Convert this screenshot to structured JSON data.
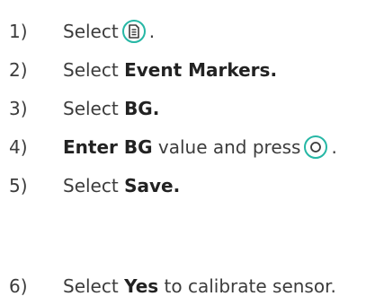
{
  "accent_color": "#26b7a5",
  "steps": [
    {
      "number": "1)",
      "text_a": "Select",
      "icon": "menu-document-icon",
      "text_b": "."
    },
    {
      "number": "2)",
      "text_a": "Select ",
      "bold": "Event Markers."
    },
    {
      "number": "3)",
      "text_a": "Select ",
      "bold": "BG."
    },
    {
      "number": "4)",
      "bold": "Enter BG",
      "text_a": " value and press",
      "icon": "select-button-icon",
      "text_b": "."
    },
    {
      "number": "5)",
      "text_a": "Select ",
      "bold": "Save."
    },
    {
      "number": "6)",
      "text_a": "Select ",
      "bold": "Yes",
      "text_b": " to calibrate sensor."
    }
  ]
}
